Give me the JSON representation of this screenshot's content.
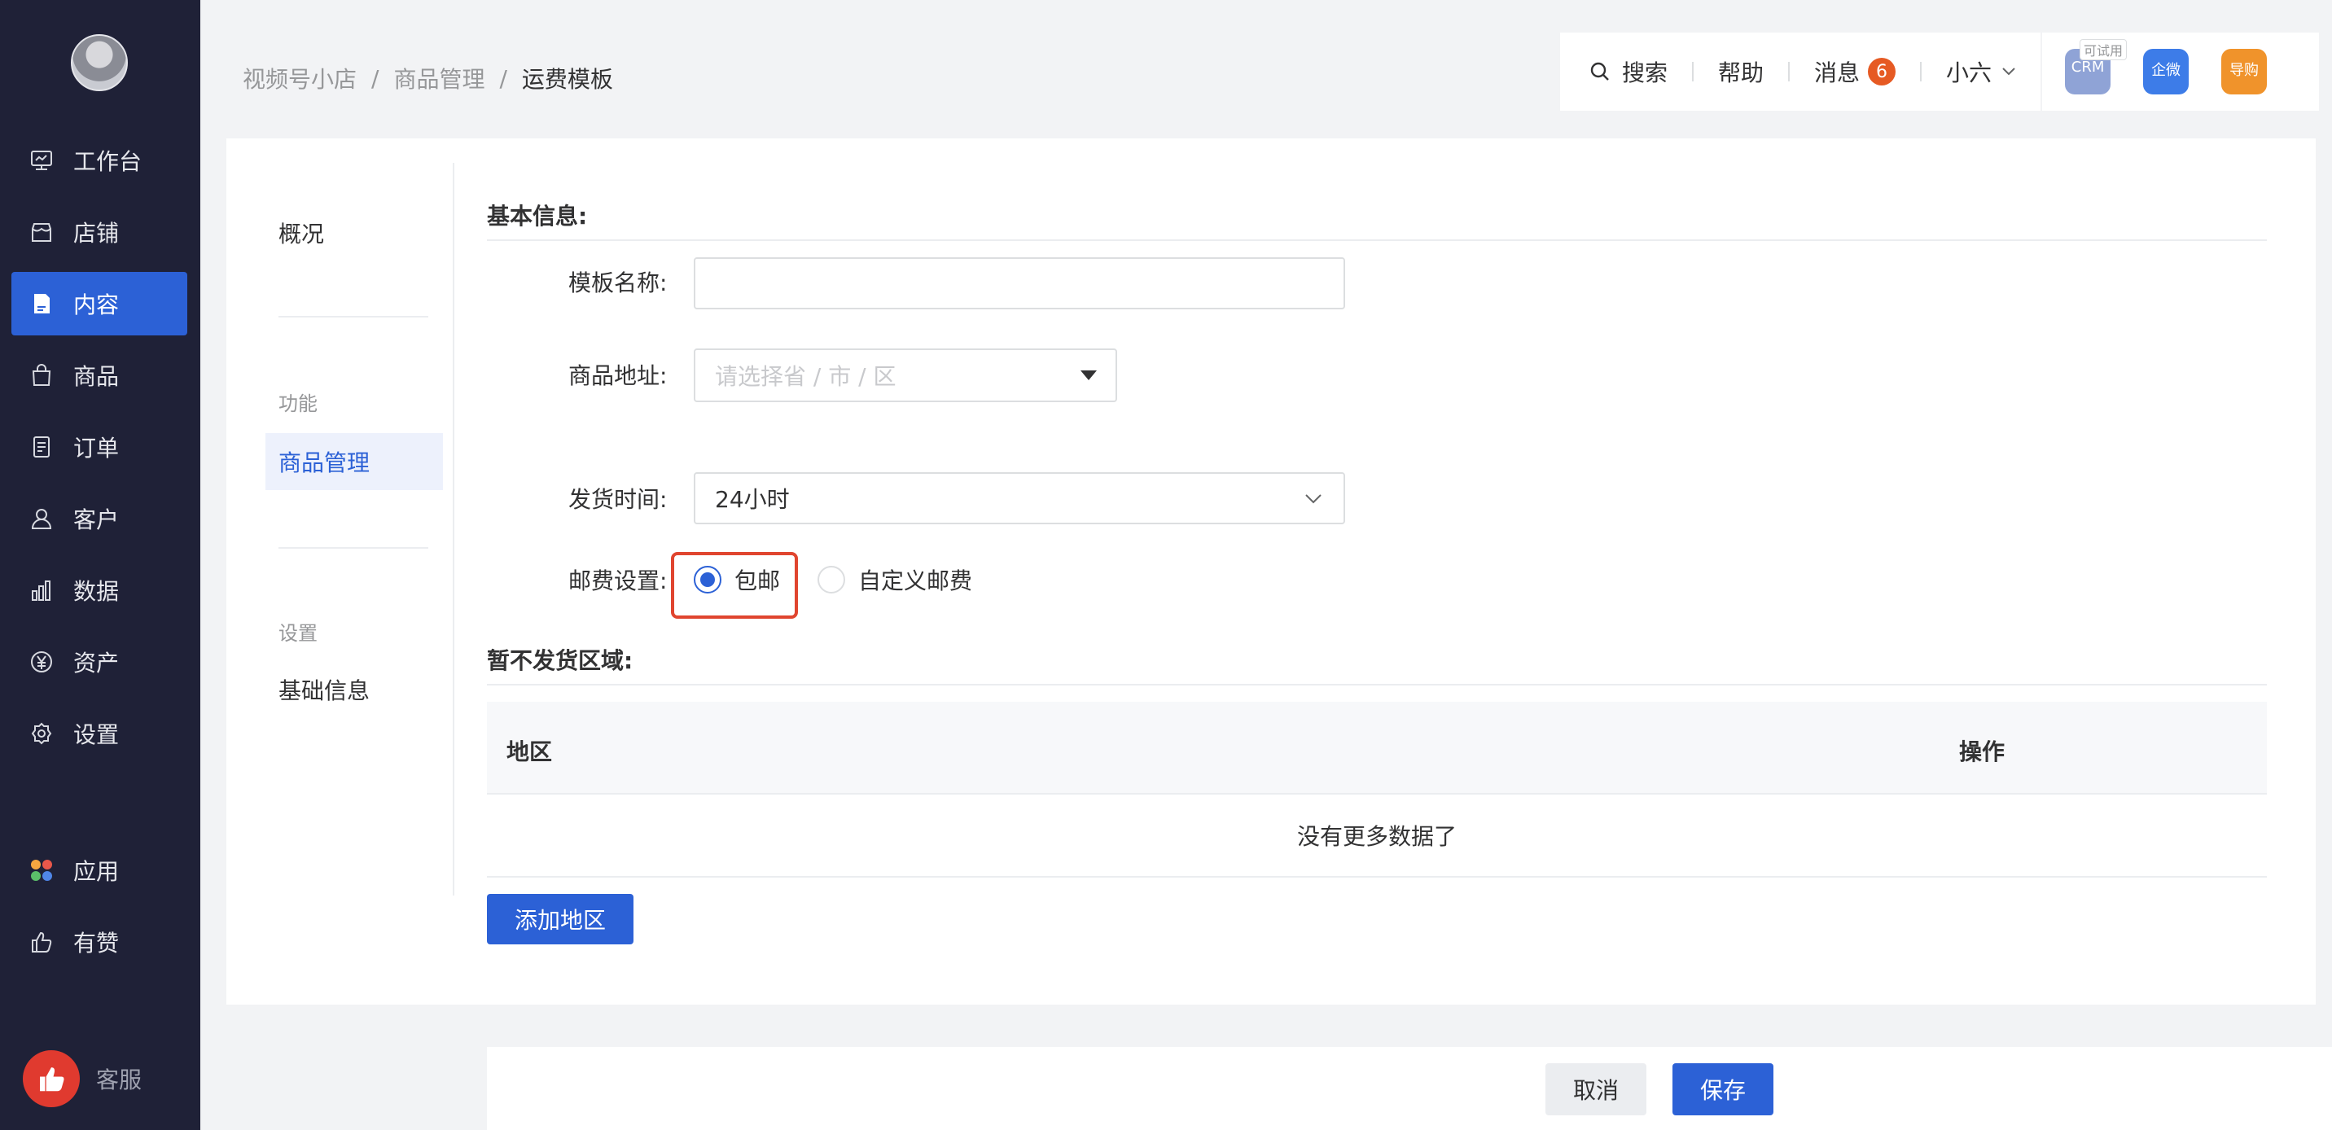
{
  "sidebar": {
    "items": [
      {
        "label": "工作台",
        "icon": "dashboard-icon"
      },
      {
        "label": "店铺",
        "icon": "store-icon"
      },
      {
        "label": "内容",
        "icon": "content-icon",
        "active": true
      },
      {
        "label": "商品",
        "icon": "bag-icon"
      },
      {
        "label": "订单",
        "icon": "order-icon"
      },
      {
        "label": "客户",
        "icon": "user-icon"
      },
      {
        "label": "数据",
        "icon": "chart-icon"
      },
      {
        "label": "资产",
        "icon": "yen-icon"
      },
      {
        "label": "设置",
        "icon": "gear-icon"
      }
    ],
    "extra_items": [
      {
        "label": "应用",
        "icon": "apps-icon"
      },
      {
        "label": "有赞",
        "icon": "thumb-icon"
      }
    ],
    "service_label": "客服"
  },
  "breadcrumb": {
    "items": [
      "视频号小店",
      "商品管理"
    ],
    "separator": "/",
    "current": "运费模板"
  },
  "topbar": {
    "search_label": "搜索",
    "help_label": "帮助",
    "messages_label": "消息",
    "messages_count": "6",
    "user_name": "小六",
    "apps": [
      {
        "label": "CRM",
        "tag": "可试用",
        "color": "#8fa3d6"
      },
      {
        "label": "企微",
        "color": "#3d7ce8"
      },
      {
        "label": "导购",
        "color": "#f0932b"
      }
    ]
  },
  "subnav": {
    "overview": "概况",
    "group_function": "功能",
    "item_goods": "商品管理",
    "group_settings": "设置",
    "item_basic": "基础信息"
  },
  "form": {
    "section_basic": "基本信息:",
    "template_name_label": "模板名称:",
    "template_name_value": "",
    "address_label": "商品地址:",
    "address_placeholder": "请选择省 / 市 / 区",
    "ship_time_label": "发货时间:",
    "ship_time_value": "24小时",
    "postage_label": "邮费设置:",
    "postage_options": [
      {
        "label": "包邮",
        "checked": true
      },
      {
        "label": "自定义邮费",
        "checked": false
      }
    ],
    "section_no_ship": "暂不发货区域:"
  },
  "table": {
    "columns": [
      "地区",
      "操作"
    ],
    "empty_text": "没有更多数据了"
  },
  "buttons": {
    "add_region": "添加地区",
    "cancel": "取消",
    "save": "保存"
  },
  "colors": {
    "sidebar_bg": "#1f2137",
    "primary": "#2c61d6",
    "badge": "#e65a23",
    "highlight": "#e0452f"
  }
}
